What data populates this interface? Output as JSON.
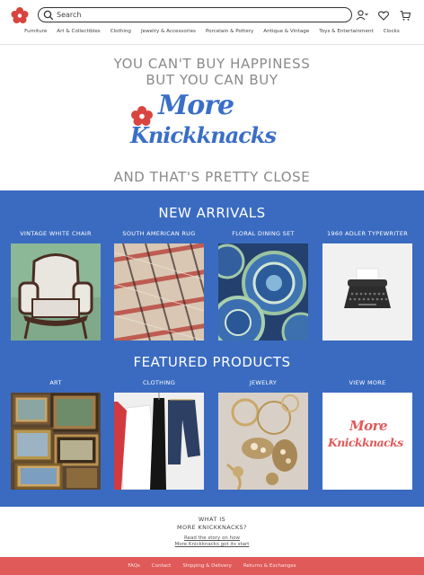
{
  "colors": {
    "accent_blue": "#3a6bc0",
    "footer_red": "#e05a5a",
    "logo_red": "#d9443f",
    "hero_gray": "#8a8a8a"
  },
  "header": {
    "logo_icon": "flower-icon",
    "search_placeholder": "Search",
    "icons": [
      "account-icon",
      "wishlist-heart-icon",
      "cart-icon"
    ],
    "nav": [
      "Furniture",
      "Art & Collectibles",
      "Clothing",
      "Jewelry & Accessories",
      "Porcelain & Pottery",
      "Antique & Vintage",
      "Toys & Entertainment",
      "Clocks"
    ]
  },
  "hero": {
    "line1": "YOU CAN'T BUY HAPPINESS",
    "line2": "BUT YOU CAN BUY",
    "brand_more": "More",
    "brand_knick": "Knickknacks",
    "line3": "AND THAT'S PRETTY CLOSE"
  },
  "new_arrivals": {
    "title": "NEW ARRIVALS",
    "items": [
      {
        "label": "VINTAGE WHITE CHAIR"
      },
      {
        "label": "SOUTH AMERICAN RUG"
      },
      {
        "label": "FLORAL DINING SET"
      },
      {
        "label": "1960 ADLER TYPEWRITER"
      }
    ]
  },
  "featured": {
    "title": "FEATURED PRODUCTS",
    "items": [
      {
        "label": "ART"
      },
      {
        "label": "CLOTHING"
      },
      {
        "label": "JEWELRY"
      },
      {
        "label": "VIEW MORE"
      }
    ],
    "view_more_logo_more": "More",
    "view_more_logo_knick": "Knickknacks"
  },
  "about": {
    "line1": "WHAT IS",
    "line2": "MORE KNICKKNACKS?",
    "link1": "Read the story on how",
    "link2": "More Knickknacks got its start"
  },
  "footer": {
    "links": [
      "FAQs",
      "Contact",
      "Shipping & Delivery",
      "Returns & Exchanges"
    ]
  }
}
